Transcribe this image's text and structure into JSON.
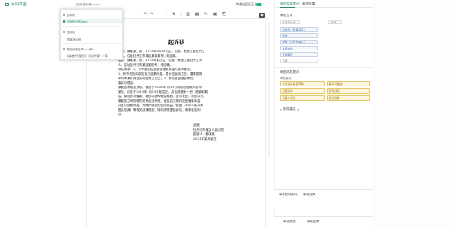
{
  "topbar": {
    "brand": "合同审查",
    "doc_name": "起诉状示例.docx",
    "right_label": "审查返回正文",
    "accent": "#2c8a64",
    "toggle_color": "#22b573"
  },
  "dropdown": {
    "items": [
      {
        "label": "起诉状",
        "highlighted": false
      },
      {
        "label": "起诉状示例.docx",
        "highlighted": true
      },
      {
        "label": "答辩状",
        "highlighted": false
      },
      {
        "label": "答辩状示例",
        "highlighted": false
      },
      {
        "label": "委托代理合同（一审）",
        "highlighted": false
      },
      {
        "label": "民事委托代理合同（诉讼代理）-一审",
        "highlighted": false
      }
    ]
  },
  "toolbar": {
    "icons": [
      "undo-icon",
      "redo-icon",
      "minus-icon",
      "plus-icon",
      "sort-icon",
      "divider",
      "print-icon",
      "grid-icon",
      "edit-icon",
      "save-icon",
      "share-icon",
      "pin-icon"
    ],
    "glyphs": [
      "↶",
      "↷",
      "−",
      "+",
      "⇅",
      "|",
      "⎙",
      "▦",
      "✎",
      "▣",
      "⎘",
      "◆"
    ]
  },
  "document": {
    "title": "起诉状",
    "lines": [
      "原告：薛某某，男，1973年5月18日生，汉族，黑龙江省牡丹江",
      "市人，住址牡丹江市某区某街某号，电话略。",
      "被告：薛某某，男，1973年某日生，汉族，黑龙江省牡丹江市",
      "人，住址牡丹江市某区某街号，电话略。",
      "    诉讼请求：1、判令被告偿还原告借款本金人民币某元；",
      "2、判令被告向原告支付逾期利息，暂计至起诉之日，要求按照",
      "年利率某计算至实际还清之日止；3、诉讼费由被告承担。",
      "    事实与理由：",
      "    原被告系朋友关系。被告于2018年1月15日向原告借款人民币",
      "某元，约定于2019年1月15日前偿还，并出具借条一份。借款到期",
      "后，原告多次催要，被告以各种理由推脱，至今未还。原告认为，",
      "原被告之间的借贷关系合法有效，被告应当按约偿还借款本金",
      "并支付逾期利息。为维护原告的合法权益，依据《中华人民共和",
      "国民法典》等相关法律规定，特向贵院提起诉讼，请求依法判",
      "决。",
      "    此致",
      "牡丹江市某区人民法院"
    ],
    "signature": [
      "起诉人：薛某某",
      "2021年某月某日"
    ]
  },
  "right_panel": {
    "tabs": [
      "审查智能提问",
      "审查结果"
    ],
    "sections": {
      "basic": {
        "title": "审查立场",
        "rows": [
          {
            "label": "合同类型",
            "value": "民事起诉状",
            "small": "选择"
          },
          {
            "label": "",
            "value": "起诉状（民事诉讼）",
            "small": ""
          },
          {
            "label": "",
            "value": "原告",
            "small": ""
          },
          {
            "label": "",
            "value": "被告（对方当事人）",
            "small": ""
          },
          {
            "label": "",
            "value": "借贷纠纷",
            "small": ""
          },
          {
            "label": "",
            "value": "普通审查",
            "small": ""
          },
          {
            "label": "",
            "value": "不限",
            "small": ""
          }
        ]
      },
      "risk": {
        "title": "审查风险提示",
        "subtitle": "审查要点",
        "chips": [
          "诉讼请求是否明确",
          "事实与理由",
          "证据清单",
          "管辖法院",
          "当事人信息",
          "诉讼时效"
        ]
      },
      "suggest": {
        "title": "修改建议",
        "count": "1"
      }
    },
    "bottom_tabs_1": [
      "审查智能提问",
      "审查结果"
    ],
    "bottom_tabs_2": [
      "审查智能",
      "审查结果"
    ]
  }
}
